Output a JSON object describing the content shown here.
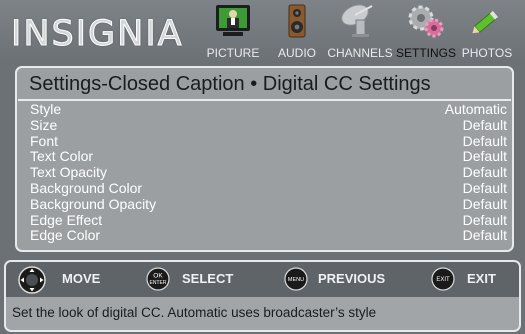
{
  "brand": "INSIGNIA",
  "menu": [
    {
      "label": "PICTURE",
      "icon": "picture-icon"
    },
    {
      "label": "AUDIO",
      "icon": "speaker-icon"
    },
    {
      "label": "CHANNELS",
      "icon": "satellite-dish-icon"
    },
    {
      "label": "SETTINGS",
      "icon": "gears-icon"
    },
    {
      "label": "PHOTOS",
      "icon": "pencil-photo-icon"
    }
  ],
  "panel": {
    "title": "Settings-Closed Caption • Digital CC Settings",
    "rows": [
      {
        "name": "Style",
        "value": "Automatic"
      },
      {
        "name": "Size",
        "value": "Default"
      },
      {
        "name": "Font",
        "value": "Default"
      },
      {
        "name": "Text Color",
        "value": "Default"
      },
      {
        "name": "Text Opacity",
        "value": "Default"
      },
      {
        "name": "Background Color",
        "value": "Default"
      },
      {
        "name": "Background Opacity",
        "value": "Default"
      },
      {
        "name": "Edge Effect",
        "value": "Default"
      },
      {
        "name": "Edge Color",
        "value": "Default"
      }
    ]
  },
  "hints": {
    "move": "MOVE",
    "select": "SELECT",
    "select_btn_top": "OK",
    "select_btn_bottom": "ENTER",
    "previous": "PREVIOUS",
    "previous_btn": "MENU",
    "exit": "EXIT",
    "exit_btn": "EXIT"
  },
  "help_text": "Set the look of digital CC. Automatic uses broadcaster’s style",
  "colors": {
    "background": "#6c7175",
    "panel": "#9c9fa2",
    "panel_border": "#e7e9ea",
    "hint_bar": "#5f6468",
    "active_menu_text": "#111111"
  }
}
